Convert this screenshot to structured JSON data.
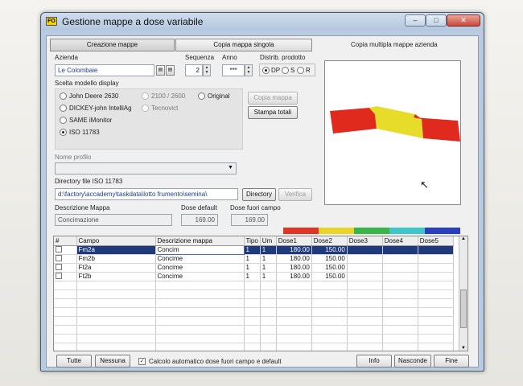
{
  "window": {
    "title": "Gestione mappe a dose variabile",
    "icon_text": "FO"
  },
  "tabs": [
    {
      "label": "Creazione mappe"
    },
    {
      "label": "Copia mappa singola"
    },
    {
      "label": "Copia  multipla mappe azienda"
    }
  ],
  "azienda": {
    "label": "Azienda",
    "value": "Le Colombaie"
  },
  "sequenza": {
    "label": "Sequenza",
    "value": "2"
  },
  "anno": {
    "label": "Anno",
    "value": "***"
  },
  "distrib": {
    "label": "Distrib. prodotto",
    "options": [
      "DP",
      "S",
      "R"
    ],
    "selected": "DP"
  },
  "display_model": {
    "label": "Scelta modello display",
    "options": [
      {
        "label": "John Deere 2630",
        "enabled": true,
        "selected": false
      },
      {
        "label": "2100 / 2600",
        "enabled": false,
        "selected": false
      },
      {
        "label": "Original",
        "enabled": true,
        "selected": false
      },
      {
        "label": "DICKEY-john IntelliAg",
        "enabled": true,
        "selected": false
      },
      {
        "label": "Tecnovict",
        "enabled": false,
        "selected": false
      },
      {
        "label": "SAME iMonitor",
        "enabled": true,
        "selected": false
      },
      {
        "label": "ISO 11783",
        "enabled": true,
        "selected": true
      }
    ]
  },
  "buttons": {
    "copia_mappa": "Copia mappa",
    "stampa_totali": "Stampa totali",
    "directory": "Directory",
    "verifica": "Verifica",
    "tutte": "Tutte",
    "nessuna": "Nessuna",
    "info": "Info",
    "nascondi": "Nasconde",
    "fine": "Fine"
  },
  "nome_profilo": {
    "label": "Nome profilo",
    "value": ""
  },
  "directory_iso": {
    "label": "Directory file ISO 11783",
    "value": "d:\\factory\\accademy\\taskdata\\lotto frumento\\semina\\"
  },
  "descrizione_mappa": {
    "label": "Descrizione Mappa",
    "value": "Concimazione"
  },
  "dose_default": {
    "label": "Dose default",
    "value": "169.00"
  },
  "dose_fuori": {
    "label": "Dose fuori  campo",
    "value": "169.00"
  },
  "dose_colors": [
    "#e03526",
    "#e8d42a",
    "#3ab54a",
    "#3fc6c8",
    "#2a3fbf"
  ],
  "map_colors": {
    "red": "#e02a1e",
    "yellow": "#e8dc2a"
  },
  "table": {
    "columns": [
      "#",
      "Campo",
      "Descrizione mappa",
      "Tipo",
      "Um",
      "Dose1",
      "Dose2",
      "Dose3",
      "Dose4",
      "Dose5"
    ],
    "rows": [
      {
        "campo": "Fm2a",
        "descr": "Concim",
        "tipo": "1",
        "um": "1",
        "dose1": "180.00",
        "dose2": "150.00",
        "selected": true
      },
      {
        "campo": "Fm2b",
        "descr": "Concime",
        "tipo": "1",
        "um": "1",
        "dose1": "180.00",
        "dose2": "150.00",
        "selected": false
      },
      {
        "campo": "Ft2a",
        "descr": "Concime",
        "tipo": "1",
        "um": "1",
        "dose1": "180.00",
        "dose2": "150.00",
        "selected": false
      },
      {
        "campo": "Ft2b",
        "descr": "Concime",
        "tipo": "1",
        "um": "1",
        "dose1": "180.00",
        "dose2": "150.00",
        "selected": false
      }
    ]
  },
  "calcolo": {
    "label": "Calcolo automatico dose fuori campo e default",
    "checked": true
  }
}
